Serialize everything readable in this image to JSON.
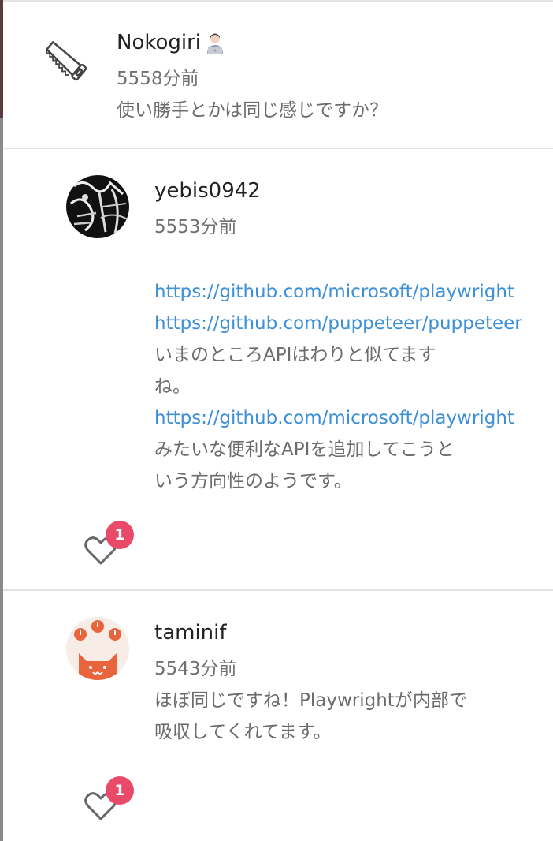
{
  "comments": [
    {
      "username": "Nokogiri",
      "user_emoji": "technologist-emoji",
      "avatar_icon": "saw-icon",
      "timestamp": "5558分前",
      "text": "使い勝手とかは同じ感じですか？"
    },
    {
      "username": "yebis0942",
      "avatar_icon": "calligraphy-avatar",
      "timestamp": "5553分前",
      "lines": [
        {
          "type": "link",
          "text": "https://github.com/microsoft/playwright"
        },
        {
          "type": "link",
          "text": "https://github.com/puppeteer/puppeteer"
        },
        {
          "type": "plain",
          "text": "いまのところAPIはわりと似てます"
        },
        {
          "type": "plain",
          "text": "ね。"
        },
        {
          "type": "link",
          "text": "https://github.com/microsoft/playwright"
        },
        {
          "type": "plain",
          "text": "みたいな便利なAPIを追加してこうと"
        },
        {
          "type": "plain",
          "text": "いう方向性のようです。"
        }
      ],
      "like_count": "1"
    },
    {
      "username": "taminif",
      "avatar_icon": "cat-avatar",
      "timestamp": "5543分前",
      "lines": [
        {
          "type": "plain",
          "text": "ほぼ同じですね！Playwrightが内部で"
        },
        {
          "type": "plain",
          "text": "吸収してくれてます。"
        }
      ],
      "like_count": "1"
    }
  ],
  "colors": {
    "link": "#3d8fd8",
    "badge": "#ea4a6a",
    "cat_avatar": "#e8643c"
  }
}
